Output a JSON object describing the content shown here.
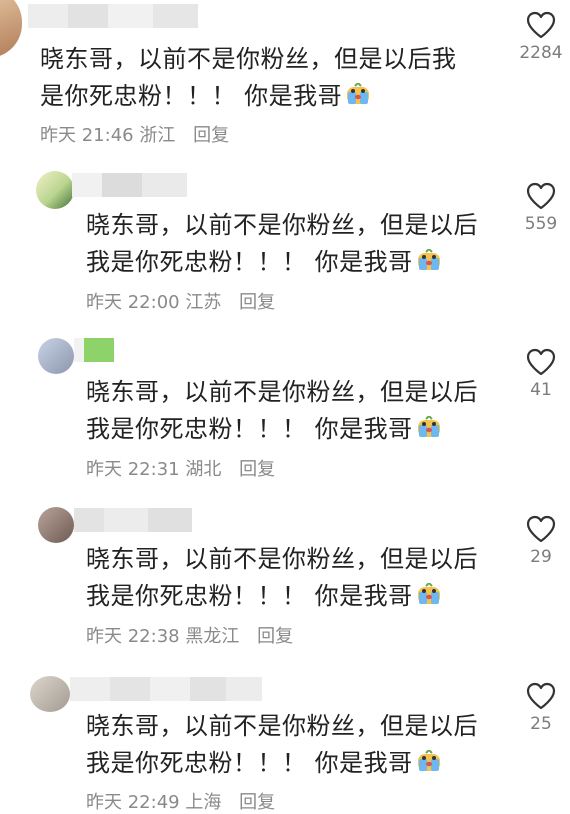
{
  "comments": [
    {
      "text_line1": "晓东哥，以前不是你粉丝，但是以后我",
      "text_line2": "是你死忠粉！！！ 你是我哥",
      "date": "昨天",
      "time": "21:46",
      "location": "浙江",
      "reply_label": "回复",
      "likes": "2284",
      "emoji": "crying-face-icon"
    },
    {
      "text_line1": "晓东哥，以前不是你粉丝，但是以后",
      "text_line2": "我是你死忠粉！！！ 你是我哥",
      "date": "昨天",
      "time": "22:00",
      "location": "江苏",
      "reply_label": "回复",
      "likes": "559",
      "emoji": "crying-face-icon"
    },
    {
      "text_line1": "晓东哥，以前不是你粉丝，但是以后",
      "text_line2": "我是你死忠粉！！！ 你是我哥",
      "date": "昨天",
      "time": "22:31",
      "location": "湖北",
      "reply_label": "回复",
      "likes": "41",
      "emoji": "crying-face-icon"
    },
    {
      "text_line1": "晓东哥，以前不是你粉丝，但是以后",
      "text_line2": "我是你死忠粉！！！ 你是我哥",
      "date": "昨天",
      "time": "22:38",
      "location": "黑龙江",
      "reply_label": "回复",
      "likes": "29",
      "emoji": "crying-face-icon"
    },
    {
      "text_line1": "晓东哥，以前不是你粉丝，但是以后",
      "text_line2": "我是你死忠粉！！！ 你是我哥",
      "date": "昨天",
      "time": "22:49",
      "location": "上海",
      "reply_label": "回复",
      "likes": "25",
      "emoji": "crying-face-icon"
    }
  ],
  "colors": {
    "text": "#222222",
    "meta": "#8a8a8a",
    "like_outline": "#333333",
    "like_count": "#7c7c7c"
  }
}
